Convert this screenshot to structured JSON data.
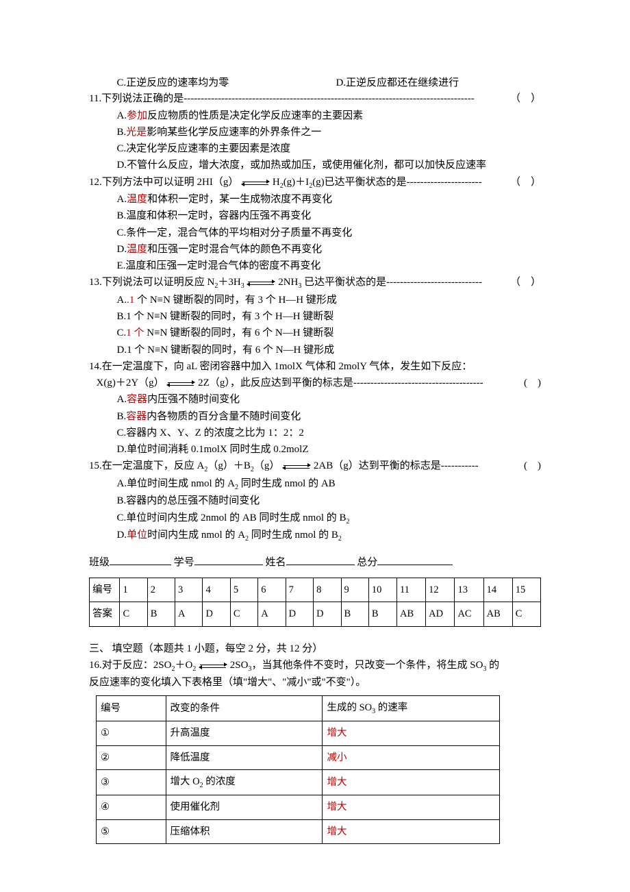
{
  "q10": {
    "C": "C.正逆反应的速率均为零",
    "D": "D.正逆反应都还在继续进行"
  },
  "q11": {
    "stem": "11.下列说法正确的是",
    "tail": "（　）",
    "A_pre": "A.",
    "A_red": "参加",
    "A_post": "反应物质的性质是决定化学反应速率的主要因素",
    "B_pre": "B.",
    "B_red": "光是",
    "B_post": "影响某些化学反应速率的外界条件之一",
    "C": "C.决定化学反应速率的主要因素是浓度",
    "D": "D.不管什么反应，增大浓度，或加热或加压，或使用催化剂，都可以加快反应速率"
  },
  "q12": {
    "stem_pre": "12.下列方法中可以证明 2HI（g）",
    "stem_post": " H",
    "stem_post2": "(g)＋I",
    "stem_post3": "(g)已达平衡状态的是",
    "tail": "（　）",
    "A_pre": "A.",
    "A_red": "温度",
    "A_post": "和体积一定时，某一生成物浓度不再变化",
    "B": "B.温度和体积一定时，容器内压强不再变化",
    "C": "C.条件一定，混合气体的平均相对分子质量不再变化",
    "D_pre": "D.",
    "D_red": "温度",
    "D_post": "和压强一定时混合气体的颜色不再变化",
    "E": "E.温度和压强一定时混合气体的密度不再变化"
  },
  "q13": {
    "stem_pre": "13.下列说法可以证明反应 N",
    "stem_mid": "＋3H",
    "stem_post": " 2NH",
    "stem_end": " 已达平衡状态的是",
    "tail": "（　）",
    "A_pre": "A.",
    "A_red": ".1",
    "A_post": " 个 N≡N 键断裂的同时，有 3 个 H—H 键形成",
    "B": "B.1 个 N≡N 键断裂的同时，有 3 个 H—H 键断裂",
    "C_pre": "C.",
    "C_red": "1 个",
    "C_post": " N≡N 键断裂的同时，有 6 个 N—H 键断裂",
    "D": "D.1 个 N≡N 键断裂的同时，有 6 个 N—H 键形成"
  },
  "q14": {
    "stem1_pre": "14.在一定温度下，向 aL 密闭容器中加入 1molX 气体和 2molY 气体，发生如下反应：",
    "stem2_pre": "X(g)＋2Y（g）",
    "stem2_post": " 2Z（g），此反应达到平衡的标志是",
    "tail": "(　)",
    "A_pre": "A.",
    "A_red": "容器",
    "A_post": "内压强不随时间变化",
    "B_pre": "B.",
    "B_red": "容器",
    "B_post": "内各物质的百分含量不随时间变化",
    "C": "C.容器内 X、Y、Z 的浓度之比为 1：2：2",
    "D": "D.单位时间消耗 0.1molX 同时生成 0.2molZ"
  },
  "q15": {
    "stem_pre": "15.在一定温度下，反应 A",
    "stem_mid1": "（g）＋B",
    "stem_mid2": "（g）",
    "stem_post": " 2AB（g）达到平衡的标志是",
    "tail": "(　)",
    "A": "A.单位时间生成 nmol 的 A",
    "A2": " 同时生成 nmol 的 AB",
    "B": "B.容器内的总压强不随时间变化",
    "C": "C.单位时间内生成 2nmol 的 AB 同时生成 nmol 的 B",
    "D_pre": "D.",
    "D_red": "单位",
    "D_post": "时间内生成 nmol 的 A",
    "D_post2": " 同时生成 nmol 的 B"
  },
  "form": {
    "class": "班级",
    "id": "学号",
    "name": "姓名",
    "score": "总分"
  },
  "answer_table": {
    "head": [
      "编号",
      "1",
      "2",
      "3",
      "4",
      "5",
      "6",
      "7",
      "8",
      "9",
      "10",
      "11",
      "12",
      "13",
      "14",
      "15"
    ],
    "row": [
      "答案",
      "C",
      "B",
      "A",
      "D",
      "C",
      "A",
      "D",
      "D",
      "B",
      "B",
      "AB",
      "AD",
      "AC",
      "AB",
      "C"
    ]
  },
  "section3": "三、 填空题（本题共 1 小题，每空 2 分，共 12 分）",
  "q16": {
    "line1_pre": "16.对于反应：2SO",
    "line1_mid": "＋O",
    "line1_post": " 2SO",
    "line1_end": "，当其他条件不变时，只改变一个条件，将生成 SO",
    "line1_end2": " 的",
    "line2": "反应速率的变化填入下表格里（填\"增大\"、\"减小\"或\"不变\"）。",
    "head": [
      "编号",
      "改变的条件",
      "生成的 SO₃ 的速率"
    ],
    "rows": [
      {
        "n": "①",
        "cond": "升高温度",
        "eff": "增大"
      },
      {
        "n": "②",
        "cond": "降低温度",
        "eff": "减小"
      },
      {
        "n": "③",
        "cond": "增大 O₂ 的浓度",
        "eff": "增大"
      },
      {
        "n": "④",
        "cond": "使用催化剂",
        "eff": "增大"
      },
      {
        "n": "⑤",
        "cond": "压缩体积",
        "eff": "增大"
      }
    ]
  }
}
